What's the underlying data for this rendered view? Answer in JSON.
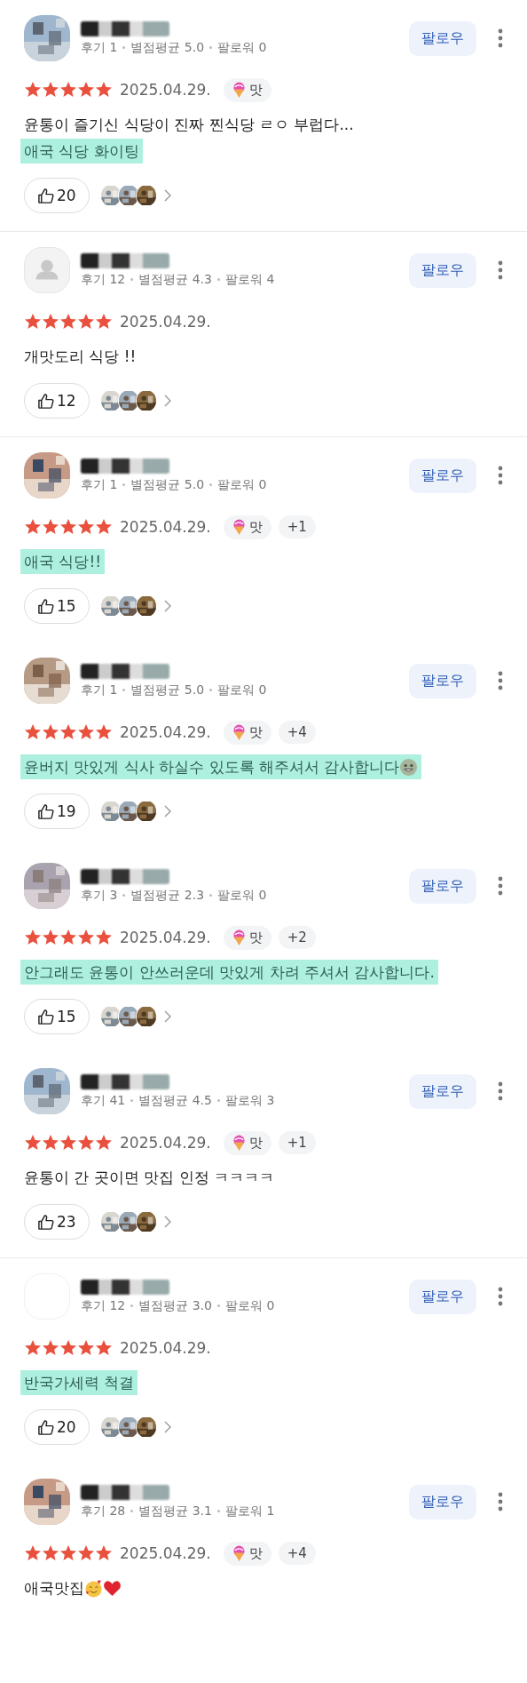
{
  "reviews": [
    {
      "avatar": {
        "kind": "picture"
      },
      "meta": [
        "후기 1",
        "별점평균 5.0",
        "팔로워 0"
      ],
      "follow": "팔로우",
      "stars": 5,
      "date": "2025.04.29.",
      "tags": [
        {
          "kind": "taste",
          "label": "맛"
        }
      ],
      "lines": [
        {
          "text": "윤통이 즐기신 식당이 진짜 찐식당 ㄹㅇ 부럽다...",
          "highlighted": false
        },
        {
          "text": "애국 식당 화이팅",
          "highlighted": true
        }
      ],
      "likes": "20",
      "divider": true
    },
    {
      "avatar": {
        "kind": "default"
      },
      "meta": [
        "후기 12",
        "별점평균 4.3",
        "팔로워 4"
      ],
      "follow": "팔로우",
      "stars": 5,
      "date": "2025.04.29.",
      "lines": [
        {
          "text": "개맛도리 식당 !!",
          "highlighted": false
        }
      ],
      "likes": "12",
      "divider": true
    },
    {
      "avatar": {
        "kind": "picture"
      },
      "meta": [
        "후기 1",
        "별점평균 5.0",
        "팔로워 0"
      ],
      "follow": "팔로우",
      "stars": 5,
      "date": "2025.04.29.",
      "tags": [
        {
          "kind": "taste",
          "label": "맛"
        },
        {
          "kind": "count",
          "label": "+1"
        }
      ],
      "lines": [
        {
          "text": "애국 식당!!",
          "highlighted": true
        }
      ],
      "likes": "15",
      "divider": false
    },
    {
      "avatar": {
        "kind": "picture"
      },
      "meta": [
        "후기 1",
        "별점평균 5.0",
        "팔로워 0"
      ],
      "follow": "팔로우",
      "stars": 5,
      "date": "2025.04.29.",
      "tags": [
        {
          "kind": "taste",
          "label": "맛"
        },
        {
          "kind": "count",
          "label": "+4"
        }
      ],
      "lines": [
        {
          "text": "윤버지 맛있게 식사 하실수 있도록 해주셔서 감사합니다",
          "highlighted": true,
          "emoji": [
            {
              "kind": "grin"
            }
          ]
        }
      ],
      "likes": "19",
      "divider": false
    },
    {
      "avatar": {
        "kind": "picture"
      },
      "meta": [
        "후기 3",
        "별점평균 2.3",
        "팔로워 0"
      ],
      "follow": "팔로우",
      "stars": 5,
      "date": "2025.04.29.",
      "tags": [
        {
          "kind": "taste",
          "label": "맛"
        },
        {
          "kind": "count",
          "label": "+2"
        }
      ],
      "lines": [
        {
          "text": "안그래도 윤통이 안쓰러운데 맛있게 차려 주셔서 감사합니다.",
          "highlighted": true
        }
      ],
      "likes": "15",
      "divider": false
    },
    {
      "avatar": {
        "kind": "picture"
      },
      "meta": [
        "후기 41",
        "별점평균 4.5",
        "팔로워 3"
      ],
      "follow": "팔로우",
      "stars": 5,
      "date": "2025.04.29.",
      "tags": [
        {
          "kind": "taste",
          "label": "맛"
        },
        {
          "kind": "count",
          "label": "+1"
        }
      ],
      "lines": [
        {
          "text": "윤통이 간 곳이면 맛집 인정 ㅋㅋㅋㅋ",
          "highlighted": false
        }
      ],
      "likes": "23",
      "divider": true
    },
    {
      "avatar": {
        "kind": "blank"
      },
      "meta": [
        "후기 12",
        "별점평균 3.0",
        "팔로워 0"
      ],
      "follow": "팔로우",
      "stars": 5,
      "date": "2025.04.29.",
      "lines": [
        {
          "text": "반국가세력 척결",
          "highlighted": true
        }
      ],
      "likes": "20",
      "divider": false
    },
    {
      "avatar": {
        "kind": "picture"
      },
      "meta": [
        "후기 28",
        "별점평균 3.1",
        "팔로워 1"
      ],
      "follow": "팔로우",
      "stars": 5,
      "date": "2025.04.29.",
      "tags": [
        {
          "kind": "taste",
          "label": "맛"
        },
        {
          "kind": "count",
          "label": "+4"
        }
      ],
      "lines": [
        {
          "text": "애국맛집",
          "highlighted": false,
          "emoji": [
            {
              "kind": "hearts-face"
            },
            {
              "kind": "heart"
            }
          ]
        }
      ],
      "divider": false
    }
  ]
}
